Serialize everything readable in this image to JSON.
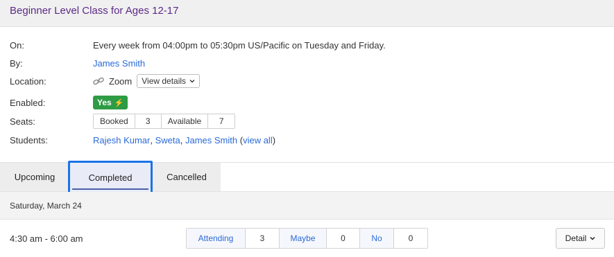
{
  "header": {
    "title": "Beginner Level Class for Ages 12-17"
  },
  "details": {
    "on_label": "On:",
    "on_value": "Every week from 04:00pm to 05:30pm US/Pacific on Tuesday and Friday.",
    "by_label": "By:",
    "by_value": "James Smith",
    "location_label": "Location:",
    "location_value": "Zoom",
    "location_button": "View details",
    "enabled_label": "Enabled:",
    "enabled_value": "Yes",
    "seats_label": "Seats:",
    "seats": {
      "booked_label": "Booked",
      "booked": "3",
      "available_label": "Available",
      "available": "7"
    },
    "students_label": "Students:",
    "students": [
      {
        "name": "Rajesh Kumar"
      },
      {
        "name": "Sweta"
      },
      {
        "name": "James Smith"
      }
    ],
    "view_all": "view all"
  },
  "tabs": [
    {
      "label": "Upcoming",
      "active": false
    },
    {
      "label": "Completed",
      "active": true
    },
    {
      "label": "Cancelled",
      "active": false
    }
  ],
  "session_group": {
    "date": "Saturday, March 24"
  },
  "session": {
    "time": "4:30 am - 6:00 am",
    "rsvp": {
      "attending_label": "Attending",
      "attending": "3",
      "maybe_label": "Maybe",
      "maybe": "0",
      "no_label": "No",
      "no": "0"
    },
    "detail_button": "Detail"
  },
  "colors": {
    "title": "#5b2a86",
    "link": "#2a6ad8",
    "enabled": "#2e9b45",
    "active_tab_border": "#1a73e8"
  }
}
